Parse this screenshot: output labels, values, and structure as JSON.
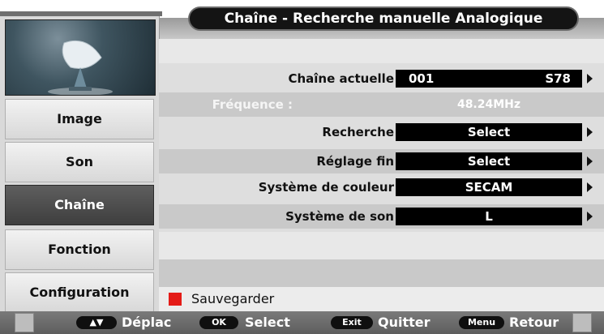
{
  "title": "Chaîne - Recherche manuelle Analogique",
  "sidebar": {
    "image_icon": "satellite-dish-icon",
    "items": [
      {
        "label": "Image",
        "active": false
      },
      {
        "label": "Son",
        "active": false
      },
      {
        "label": "Chaîne",
        "active": true
      },
      {
        "label": "Fonction",
        "active": false
      },
      {
        "label": "Configuration",
        "active": false
      }
    ]
  },
  "rows": {
    "current_channel": {
      "label": "Chaîne actuelle",
      "number": "001",
      "code": "S78"
    },
    "frequency": {
      "label": "Fréquence :",
      "value": "48.24MHz"
    },
    "search": {
      "label": "Recherche",
      "value": "Select"
    },
    "fine_tune": {
      "label": "Réglage fin",
      "value": "Select"
    },
    "color_system": {
      "label": "Système de couleur",
      "value": "SECAM"
    },
    "sound_system": {
      "label": "Système de son",
      "value": "L"
    }
  },
  "save": {
    "label": "Sauvegarder",
    "color": "#e41b17"
  },
  "bottom_bar": {
    "move": {
      "key": "▲▼",
      "label": "Déplac"
    },
    "ok": {
      "key": "OK",
      "label": "Select"
    },
    "exit": {
      "key": "Exit",
      "label": "Quitter"
    },
    "menu": {
      "key": "Menu",
      "label": "Retour"
    }
  }
}
